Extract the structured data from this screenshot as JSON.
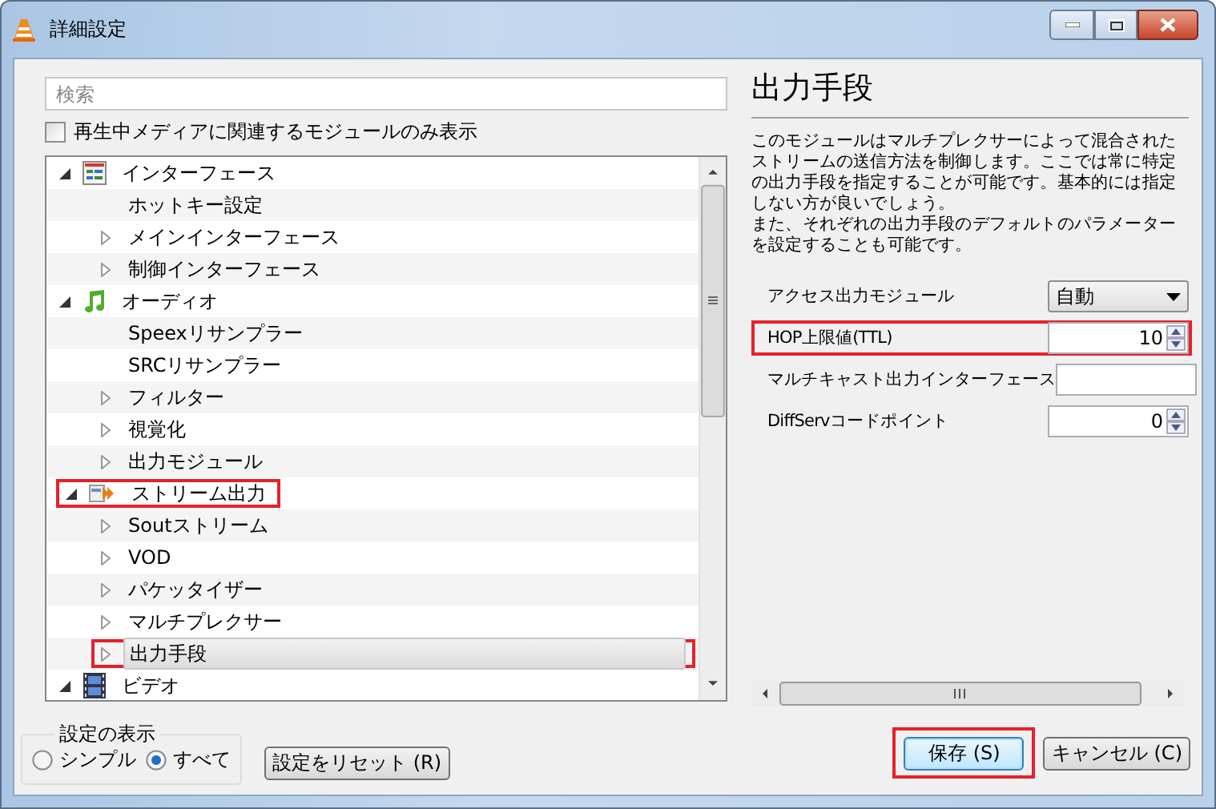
{
  "window": {
    "title": "詳細設定"
  },
  "search": {
    "placeholder": "検索"
  },
  "filter_checkbox": {
    "label": "再生中メディアに関連するモジュールのみ表示",
    "checked": false
  },
  "tree": [
    {
      "label": "インターフェース",
      "kind": "interface",
      "expanded": true,
      "selected": false,
      "highlighted": false,
      "children": [
        {
          "label": "ホットキー設定",
          "selected": false,
          "highlighted": false
        },
        {
          "label": "メインインターフェース",
          "expanded": false,
          "selected": false,
          "highlighted": false
        },
        {
          "label": "制御インターフェース",
          "expanded": false,
          "selected": false,
          "highlighted": false
        }
      ]
    },
    {
      "label": "オーディオ",
      "kind": "audio",
      "expanded": true,
      "selected": false,
      "highlighted": false,
      "children": [
        {
          "label": "Speexリサンプラー",
          "selected": false,
          "highlighted": false
        },
        {
          "label": "SRCリサンプラー",
          "selected": false,
          "highlighted": false
        },
        {
          "label": "フィルター",
          "expanded": false,
          "selected": false,
          "highlighted": false
        },
        {
          "label": "視覚化",
          "expanded": false,
          "selected": false,
          "highlighted": false
        },
        {
          "label": "出力モジュール",
          "expanded": false,
          "selected": false,
          "highlighted": false
        }
      ]
    },
    {
      "label": "ストリーム出力",
      "kind": "stream",
      "expanded": true,
      "selected": false,
      "highlighted": true,
      "children": [
        {
          "label": "Soutストリーム",
          "expanded": false,
          "selected": false,
          "highlighted": false
        },
        {
          "label": "VOD",
          "expanded": false,
          "selected": false,
          "highlighted": false
        },
        {
          "label": "パケッタイザー",
          "expanded": false,
          "selected": false,
          "highlighted": false
        },
        {
          "label": "マルチプレクサー",
          "expanded": false,
          "selected": false,
          "highlighted": false
        },
        {
          "label": "出力手段",
          "expanded": false,
          "selected": true,
          "highlighted": true
        }
      ]
    },
    {
      "label": "ビデオ",
      "kind": "video",
      "expanded": true,
      "selected": false,
      "highlighted": false
    }
  ],
  "panel": {
    "title": "出力手段",
    "description": [
      "このモジュールはマルチプレクサーによって混合されたストリームの送信方法を制御します。ここでは常に特定の出力手段を指定することが可能です。基本的には指定しない方が良いでしょう。",
      "また、それぞれの出力手段のデフォルトのパラメーターを設定することも可能です。"
    ],
    "fields": [
      {
        "kind": "dropdown",
        "label": "アクセス出力モジュール",
        "value": "自動",
        "highlighted": false
      },
      {
        "kind": "spin",
        "label": "HOP上限値(TTL)",
        "value": "10",
        "highlighted": true
      },
      {
        "kind": "text",
        "label": "マルチキャスト出力インターフェース",
        "highlighted": false
      },
      {
        "kind": "spin",
        "label": "DiffServコードポイント",
        "value": "0",
        "highlighted": false
      }
    ]
  },
  "view_group": {
    "title": "設定の表示",
    "options": [
      {
        "label": "シンプル",
        "selected": false
      },
      {
        "label": "すべて",
        "selected": true
      }
    ]
  },
  "reset_button": {
    "label": "設定をリセット (R)"
  },
  "buttons": [
    {
      "label": "保存 (S)",
      "default": true,
      "highlighted": true
    },
    {
      "label": "キャンセル (C)",
      "default": false,
      "highlighted": false
    }
  ]
}
